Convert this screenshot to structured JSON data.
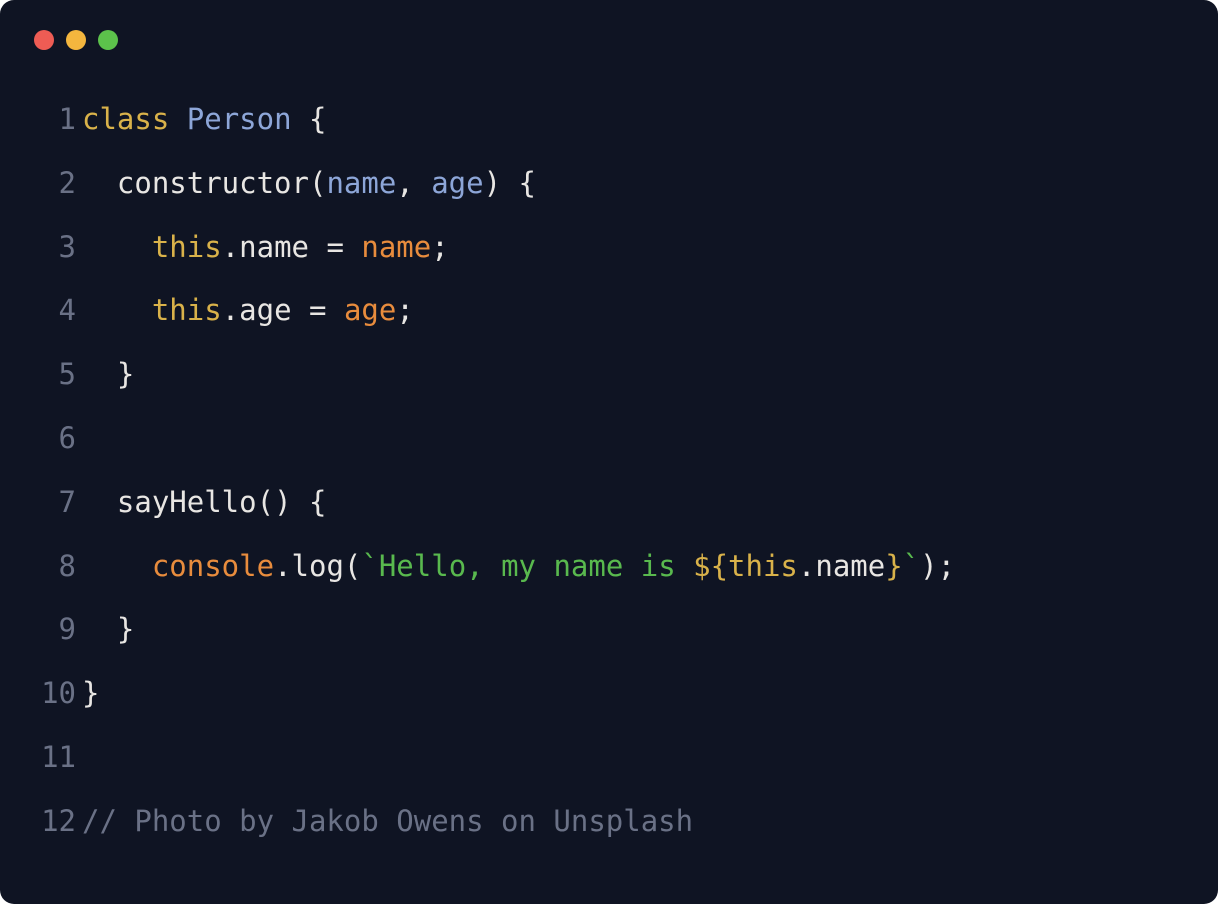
{
  "window": {
    "dots": [
      "red",
      "yellow",
      "green"
    ]
  },
  "code": {
    "lines": [
      {
        "num": "1",
        "tokens": [
          {
            "cls": "kw-class",
            "text": "class"
          },
          {
            "cls": "punct",
            "text": " "
          },
          {
            "cls": "class-name",
            "text": "Person"
          },
          {
            "cls": "punct",
            "text": " {"
          }
        ]
      },
      {
        "num": "2",
        "tokens": [
          {
            "cls": "punct",
            "text": "  "
          },
          {
            "cls": "fn-name",
            "text": "constructor"
          },
          {
            "cls": "punct",
            "text": "("
          },
          {
            "cls": "param",
            "text": "name"
          },
          {
            "cls": "punct",
            "text": ", "
          },
          {
            "cls": "param",
            "text": "age"
          },
          {
            "cls": "punct",
            "text": ") {"
          }
        ]
      },
      {
        "num": "3",
        "tokens": [
          {
            "cls": "punct",
            "text": "    "
          },
          {
            "cls": "this-kw",
            "text": "this"
          },
          {
            "cls": "punct",
            "text": "."
          },
          {
            "cls": "prop",
            "text": "name"
          },
          {
            "cls": "punct",
            "text": " = "
          },
          {
            "cls": "var-ref",
            "text": "name"
          },
          {
            "cls": "punct",
            "text": ";"
          }
        ]
      },
      {
        "num": "4",
        "tokens": [
          {
            "cls": "punct",
            "text": "    "
          },
          {
            "cls": "this-kw",
            "text": "this"
          },
          {
            "cls": "punct",
            "text": "."
          },
          {
            "cls": "prop",
            "text": "age"
          },
          {
            "cls": "punct",
            "text": " = "
          },
          {
            "cls": "var-ref",
            "text": "age"
          },
          {
            "cls": "punct",
            "text": ";"
          }
        ]
      },
      {
        "num": "5",
        "tokens": [
          {
            "cls": "punct",
            "text": "  }"
          }
        ]
      },
      {
        "num": "6",
        "tokens": []
      },
      {
        "num": "7",
        "tokens": [
          {
            "cls": "punct",
            "text": "  "
          },
          {
            "cls": "fn-name",
            "text": "sayHello"
          },
          {
            "cls": "punct",
            "text": "() {"
          }
        ]
      },
      {
        "num": "8",
        "tokens": [
          {
            "cls": "punct",
            "text": "    "
          },
          {
            "cls": "obj-ref",
            "text": "console"
          },
          {
            "cls": "punct",
            "text": "."
          },
          {
            "cls": "fn-name",
            "text": "log"
          },
          {
            "cls": "punct",
            "text": "("
          },
          {
            "cls": "string",
            "text": "`Hello, my name is "
          },
          {
            "cls": "interp-open",
            "text": "${"
          },
          {
            "cls": "this-kw",
            "text": "this"
          },
          {
            "cls": "punct",
            "text": "."
          },
          {
            "cls": "prop",
            "text": "name"
          },
          {
            "cls": "interp-close",
            "text": "}"
          },
          {
            "cls": "string",
            "text": "`"
          },
          {
            "cls": "punct",
            "text": ");"
          }
        ]
      },
      {
        "num": "9",
        "tokens": [
          {
            "cls": "punct",
            "text": "  }"
          }
        ]
      },
      {
        "num": "10",
        "tokens": [
          {
            "cls": "punct",
            "text": "}"
          }
        ]
      },
      {
        "num": "11",
        "tokens": []
      },
      {
        "num": "12",
        "tokens": [
          {
            "cls": "comment",
            "text": "// Photo by Jakob Owens on Unsplash"
          }
        ]
      }
    ]
  }
}
